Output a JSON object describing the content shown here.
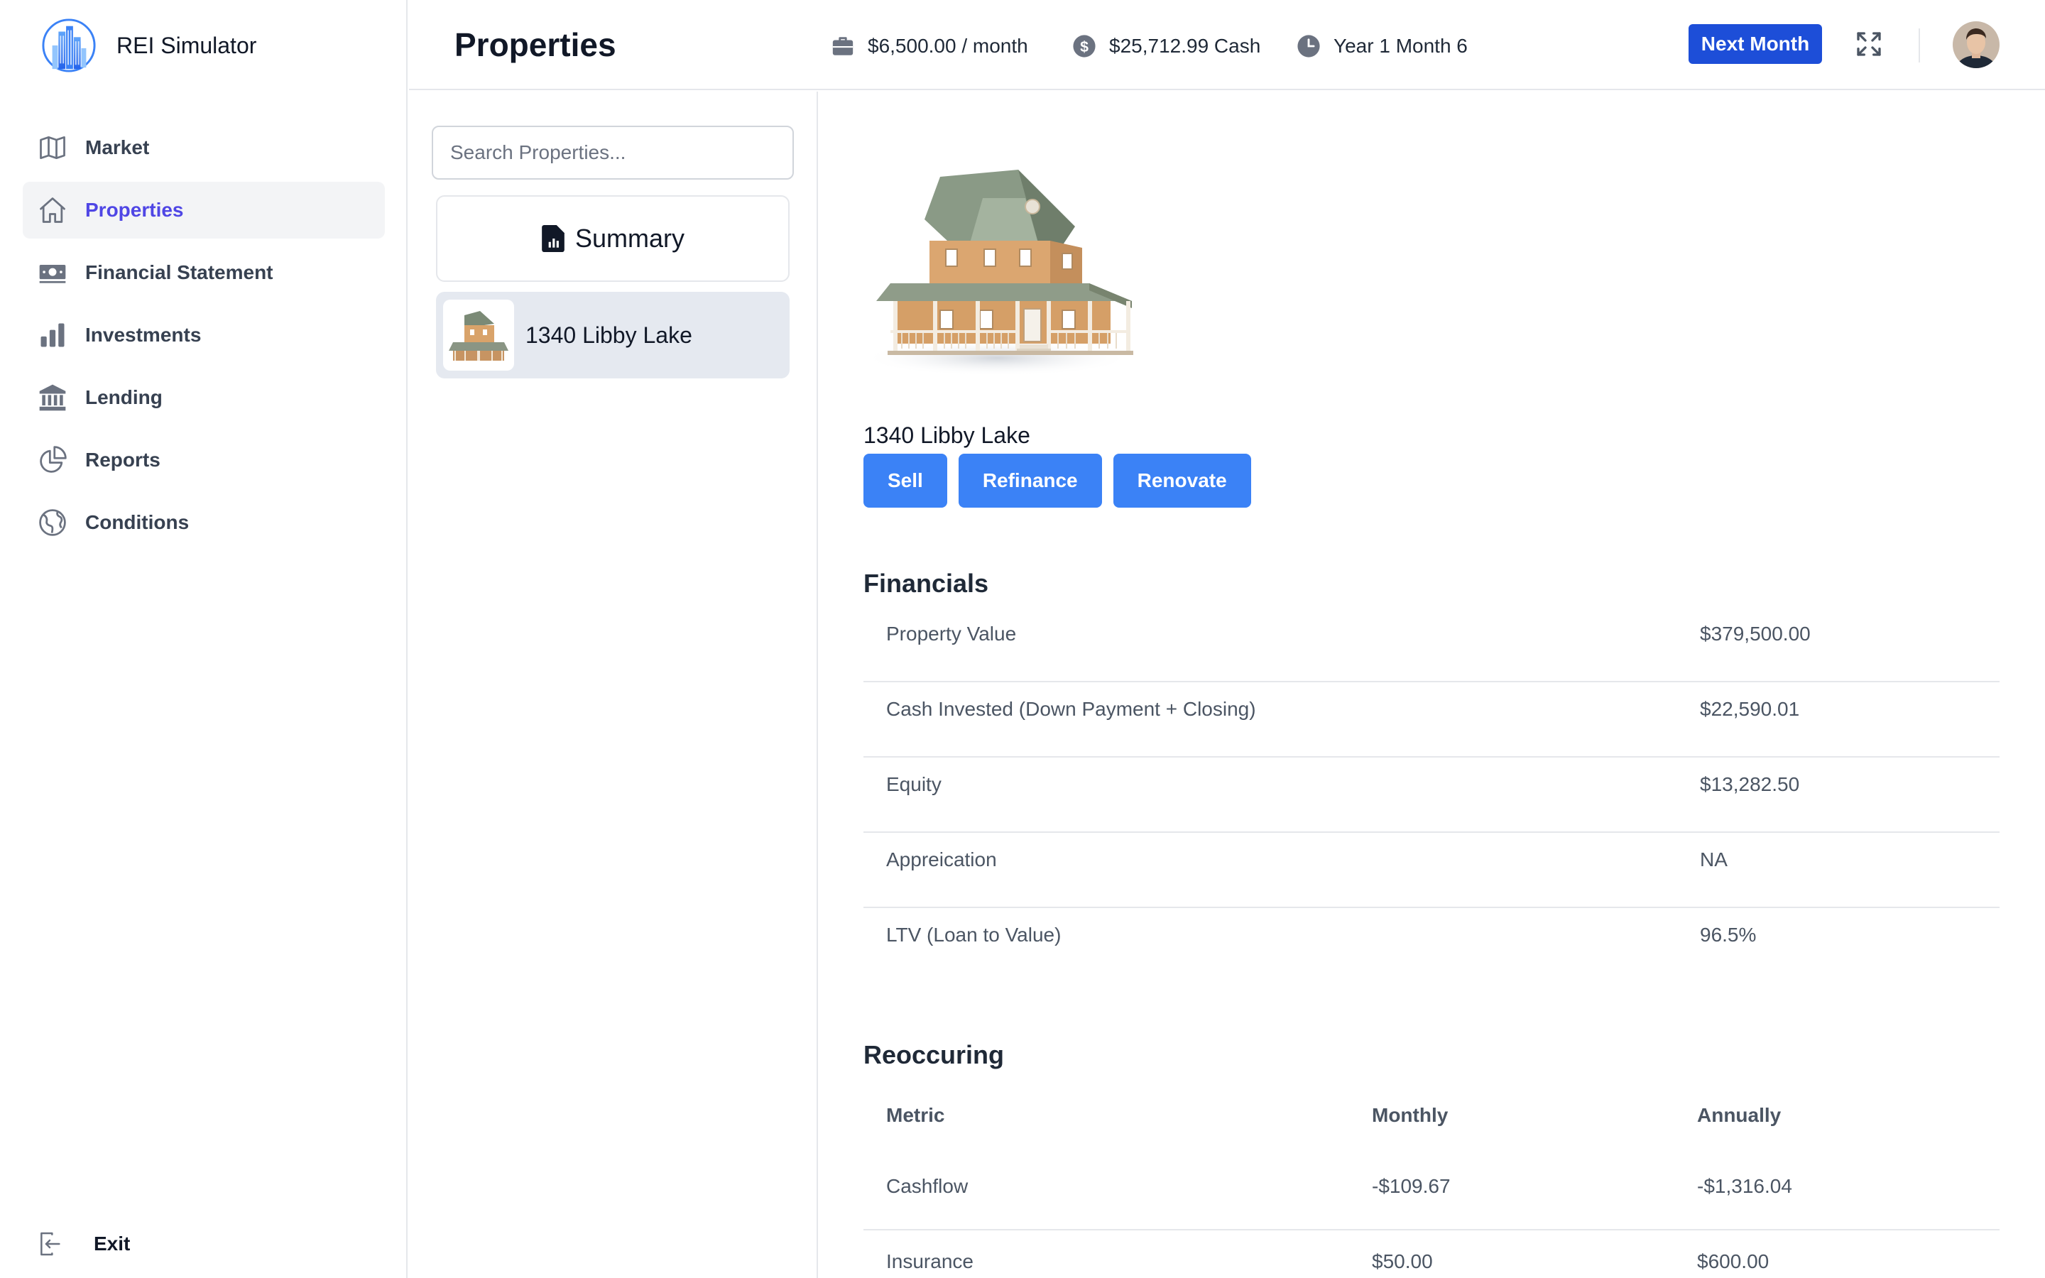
{
  "app": {
    "name": "REI Simulator"
  },
  "sidebar": {
    "items": [
      {
        "label": "Market",
        "icon": "map-icon"
      },
      {
        "label": "Properties",
        "icon": "home-icon",
        "active": true
      },
      {
        "label": "Financial Statement",
        "icon": "cash-icon"
      },
      {
        "label": "Investments",
        "icon": "bar-chart-icon"
      },
      {
        "label": "Lending",
        "icon": "bank-icon"
      },
      {
        "label": "Reports",
        "icon": "pie-chart-icon"
      },
      {
        "label": "Conditions",
        "icon": "globe-icon"
      }
    ],
    "exit_label": "Exit"
  },
  "header": {
    "title": "Properties",
    "income": "$6,500.00 / month",
    "cash": "$25,712.99 Cash",
    "date": "Year 1 Month 6",
    "next_label": "Next Month"
  },
  "list": {
    "search_placeholder": "Search Properties...",
    "summary_label": "Summary",
    "properties": [
      {
        "name": "1340 Libby Lake"
      }
    ]
  },
  "detail": {
    "name": "1340 Libby Lake",
    "actions": [
      "Sell",
      "Refinance",
      "Renovate"
    ],
    "financials_title": "Financials",
    "financials": [
      {
        "label": "Property Value",
        "value": "$379,500.00"
      },
      {
        "label": "Cash Invested (Down Payment + Closing)",
        "value": "$22,590.01"
      },
      {
        "label": "Equity",
        "value": "$13,282.50"
      },
      {
        "label": "Appreication",
        "value": "NA"
      },
      {
        "label": "LTV (Loan to Value)",
        "value": "96.5%"
      }
    ],
    "recurring_title": "Reoccuring",
    "recurring_headers": [
      "Metric",
      "Monthly",
      "Annually"
    ],
    "recurring": [
      {
        "metric": "Cashflow",
        "monthly": "-$109.67",
        "annually": "-$1,316.04"
      },
      {
        "metric": "Insurance",
        "monthly": "$50.00",
        "annually": "$600.00"
      }
    ]
  },
  "colors": {
    "accent": "#4f46e5",
    "primary_button": "#3b82f6",
    "next_button": "#1d4ed8"
  }
}
